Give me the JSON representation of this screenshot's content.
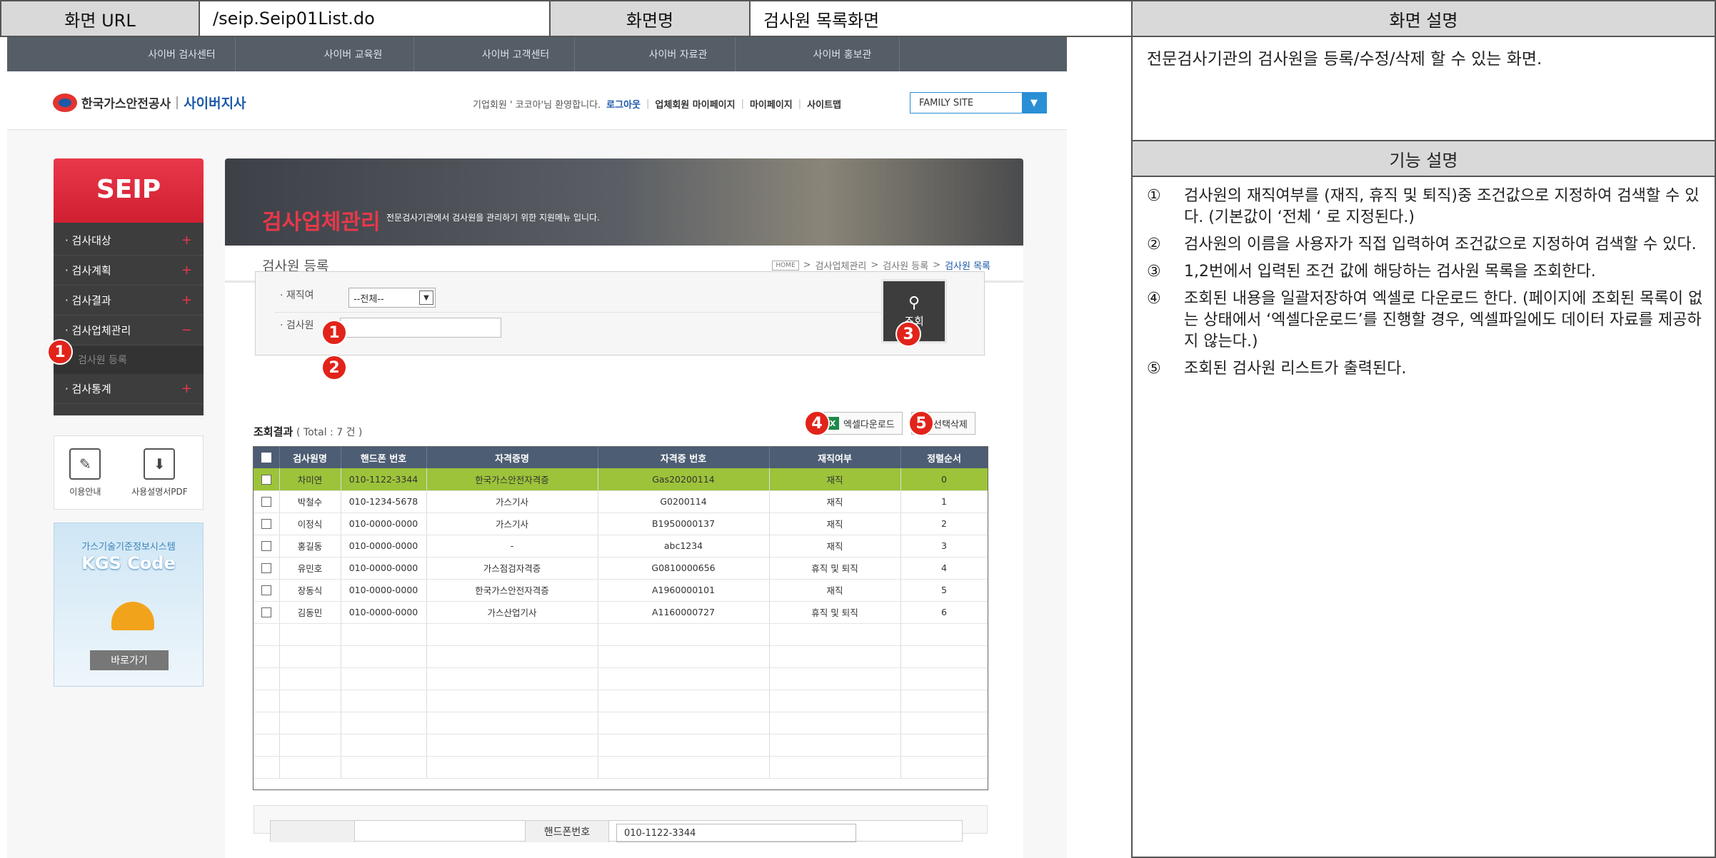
{
  "spec": {
    "url_label": "화면 URL",
    "url_value": "/seip.Seip01List.do",
    "name_label": "화면명",
    "name_value": "검사원 목록화면",
    "desc_label": "화면 설명",
    "desc_text": "전문검사기관의 검사원을 등록/수정/삭제 할 수 있는 화면.",
    "func_label": "기능 설명",
    "functions": [
      {
        "num": "①",
        "text": "검사원의 재직여부를 (재직, 휴직 및 퇴직)중 조건값으로 지정하여 검색할 수 있다. (기본값이 ‘전체 ‘ 로 지정된다.)"
      },
      {
        "num": "②",
        "text": "검사원의 이름을 사용자가 직접 입력하여 조건값으로 지정하여 검색할 수 있다."
      },
      {
        "num": "③",
        "text": "1,2번에서 입력된 조건 값에 해당하는 검사원 목록을 조회한다."
      },
      {
        "num": "④",
        "text": "조회된 내용을 일괄저장하여 엑셀로 다운로드 한다. (페이지에 조회된 목록이 없는 상태에서 ‘엑셀다운로드’를 진행할 경우, 엑셀파일에도 데이터 자료를 제공하지 않는다.)"
      },
      {
        "num": "⑤",
        "text": "조회된 검사원 리스트가 출력된다."
      }
    ]
  },
  "topnav": [
    "사이버 검사센터",
    "사이버 교육원",
    "사이버 고객센터",
    "사이버 자료관",
    "사이버 홍보관"
  ],
  "header": {
    "logo_text": "한국가스안전공사",
    "logo_sub": "사이버지사",
    "welcome": "기업회원 ' 코코아'님 환영합니다.",
    "logout": "로그아웃",
    "mypage_corp": "업체회원 마이페이지",
    "mypage": "마이페이지",
    "sitemap": "사이트맵",
    "family_site": "FAMILY SITE"
  },
  "sidebar": {
    "title": "SEIP",
    "items": [
      {
        "label": "· 검사대상",
        "mark": "+"
      },
      {
        "label": "· 검사계획",
        "mark": "+"
      },
      {
        "label": "· 검사결과",
        "mark": "+"
      },
      {
        "label": "· 검사업체관리",
        "mark": "−"
      }
    ],
    "sub_item": "검사원 등록",
    "last_item": {
      "label": "· 검사통계",
      "mark": "+"
    },
    "quick": [
      {
        "label": "이용안내",
        "icon": "guide-icon"
      },
      {
        "label": "사용설명서PDF",
        "icon": "monitor-download-icon"
      }
    ],
    "kgs_top": "가스기술기준정보시스템",
    "kgs_title": "KGS Code",
    "kgs_button": "바로가기"
  },
  "banner": {
    "title": "검사업체관리",
    "desc": "전문검사기관에서 검사원을 관리하기 위한 지원메뉴 입니다."
  },
  "page": {
    "title": "검사원 등록",
    "crumb_home": "HOME",
    "crumb": [
      "검사업체관리",
      "검사원 등록"
    ],
    "crumb_current": "검사원 목록"
  },
  "search": {
    "employ_label": "· 재직여",
    "employ_value": "--전체--",
    "name_label": "· 검사원",
    "button": "조회"
  },
  "result": {
    "label": "조회결과",
    "total": "( Total : 7 건 )",
    "excel_button": "엑셀다운로드",
    "delete_button": "선택삭제"
  },
  "table": {
    "headers": [
      "검사원명",
      "핸드폰 번호",
      "자격증명",
      "자격증 번호",
      "재직여부",
      "정렬순서"
    ],
    "rows": [
      [
        "차미연",
        "010-1122-3344",
        "한국가스안전자격증",
        "Gas20200114",
        "재직",
        "0"
      ],
      [
        "박철수",
        "010-1234-5678",
        "가스기사",
        "G0200114",
        "재직",
        "1"
      ],
      [
        "이정식",
        "010-0000-0000",
        "가스기사",
        "B1950000137",
        "재직",
        "2"
      ],
      [
        "홍길동",
        "010-0000-0000",
        "-",
        "abc1234",
        "재직",
        "3"
      ],
      [
        "유민호",
        "010-0000-0000",
        "가스점검자격증",
        "G0810000656",
        "휴직 및 퇴직",
        "4"
      ],
      [
        "장동식",
        "010-0000-0000",
        "한국가스안전자격증",
        "A1960000101",
        "재직",
        "5"
      ],
      [
        "김동민",
        "010-0000-0000",
        "가스산업기사",
        "A1160000727",
        "휴직 및 퇴직",
        "6"
      ]
    ],
    "empty_rows": 7
  },
  "detail": {
    "phone_label": "핸드폰번호",
    "phone_value": "010-1122-3344"
  },
  "badges": [
    "1",
    "1",
    "2",
    "3",
    "4",
    "5"
  ]
}
